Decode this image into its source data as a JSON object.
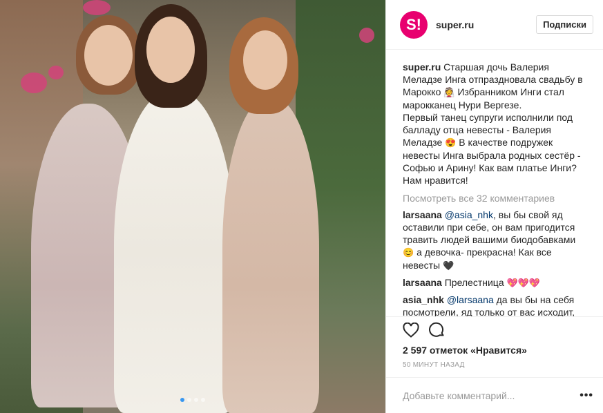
{
  "post": {
    "username": "super.ru",
    "avatar_text": "S!",
    "follow_label": "Подписки",
    "caption": {
      "username": "super.ru",
      "line1": " Старшая дочь Валерия Меладзе Инга отпраздновала свадьбу в Марокко",
      "emoji1": "👰",
      "line2": " Избранником Инги стал марокканец Нури Вергезе.",
      "line3": "Первый танец супруги исполнили под балладу отца невесты - Валерия Меладзе",
      "emoji2": "😍",
      "line4": " В качестве подружек невесты Инга выбрала родных сестёр - Софью и Арину! Как вам платье Инги? Нам нравится!"
    },
    "view_all": "Посмотреть все 32 комментариев",
    "comments": [
      {
        "user": "larsaana",
        "mention": "@asia_nhk",
        "text": ", вы бы свой яд оставили при себе, он вам пригодится травить людей вашими биодобавками ",
        "emoji": "😊",
        "text2": " а девочка- прекрасна! Как все невесты ",
        "emoji2": "🖤"
      },
      {
        "user": "larsaana",
        "text": " Прелестница ",
        "emoji": "💖💖💖"
      },
      {
        "user": "asia_nhk",
        "mention": "@larsaana",
        "text": " да вы бы на себя посмотрели, яд только от вас исходит, фууууу"
      }
    ],
    "likes": "2 597 отметок «Нравится»",
    "time": "50 минут назад",
    "add_comment_placeholder": "Добавьте комментарий...",
    "more_label": "•••",
    "icons": [
      "heart-icon",
      "comment-icon"
    ]
  }
}
